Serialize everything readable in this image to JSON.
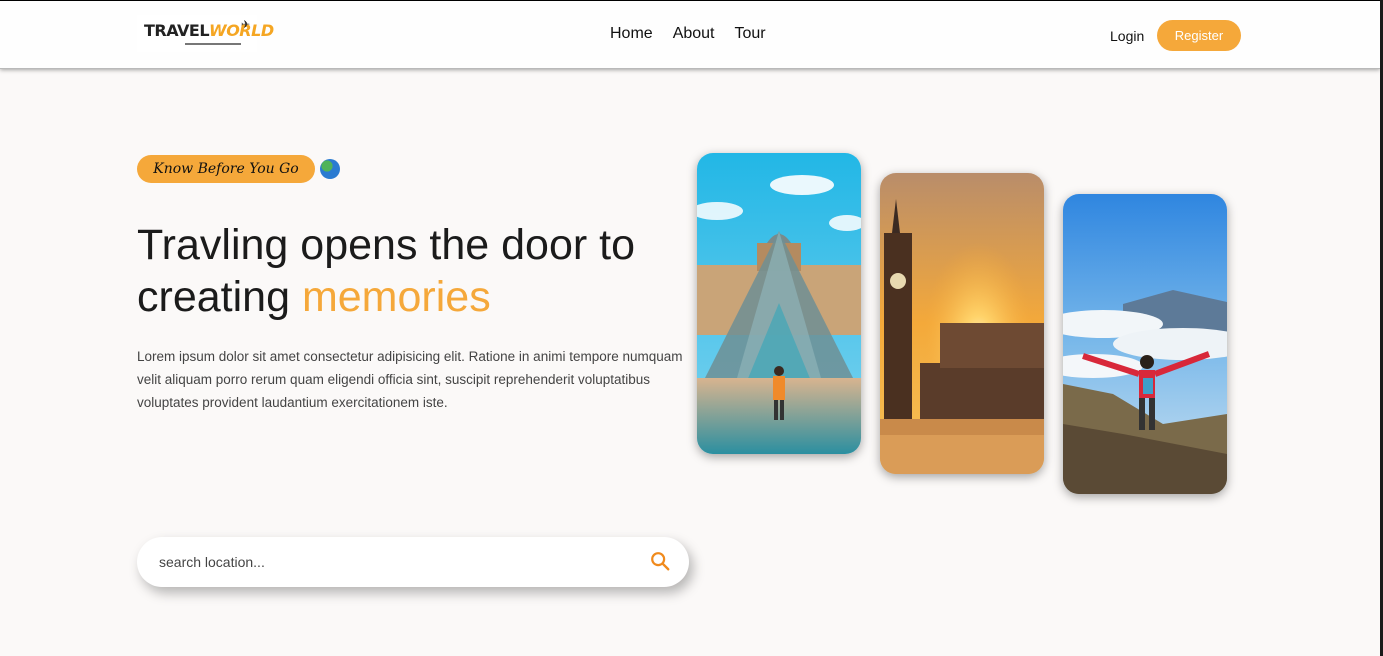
{
  "header": {
    "logo": {
      "part1": "TRAVEL",
      "part2": "WORLD"
    },
    "nav": [
      {
        "label": "Home"
      },
      {
        "label": "About"
      },
      {
        "label": "Tour"
      }
    ],
    "login_label": "Login",
    "register_label": "Register"
  },
  "hero": {
    "tagline": "Know Before You Go",
    "globe_icon": "globe-icon",
    "headline_main": "Travling opens the door to creating ",
    "headline_accent": "memories",
    "description": "Lorem ipsum dolor sit amet consectetur adipisicing elit. Ratione in animi tempore numquam velit aliquam porro rerum quam eligendi officia sint, suscipit reprehenderit voluptatibus voluptates provident laudantium exercitationem iste."
  },
  "search": {
    "placeholder": "search location...",
    "icon": "search-icon"
  },
  "colors": {
    "accent": "#f5a83a",
    "background": "#fbf9f8"
  }
}
